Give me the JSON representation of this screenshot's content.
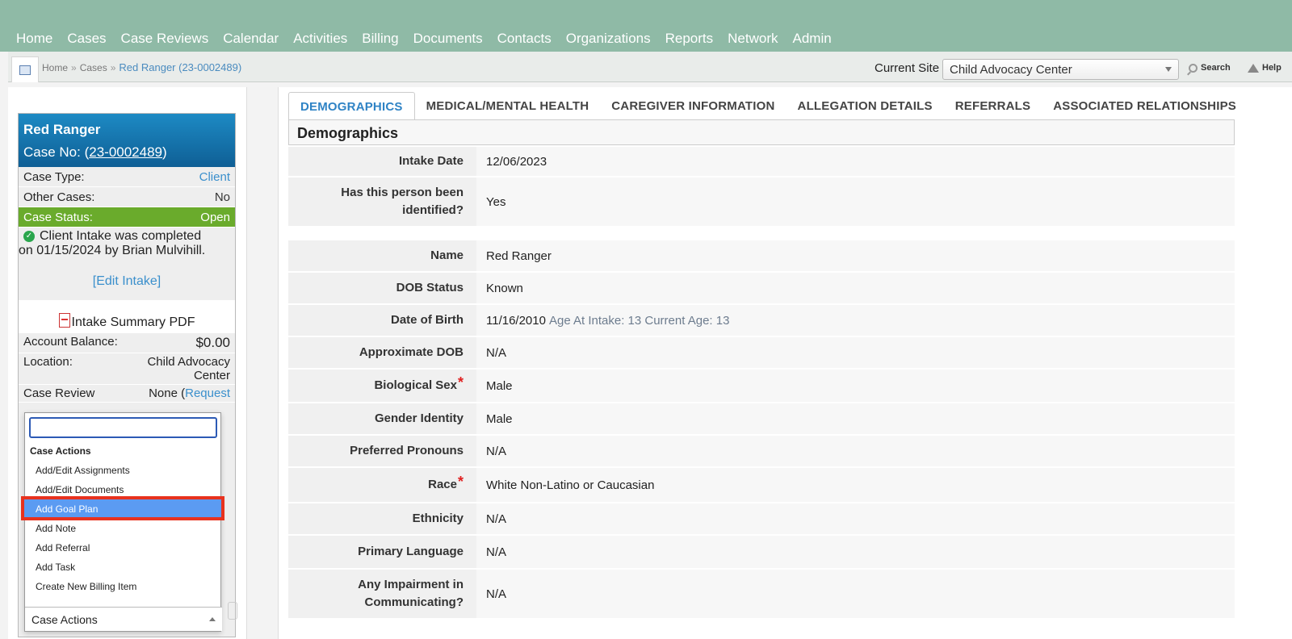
{
  "nav": {
    "items": [
      "Home",
      "Cases",
      "Case Reviews",
      "Calendar",
      "Activities",
      "Billing",
      "Documents",
      "Contacts",
      "Organizations",
      "Reports",
      "Network",
      "Admin"
    ]
  },
  "breadcrumb": {
    "home": "Home",
    "sep": "»",
    "cases": "Cases",
    "current": "Red Ranger (23-0002489)"
  },
  "site": {
    "label": "Current Site",
    "value": "Child Advocacy Center"
  },
  "toplinks": {
    "search": "Search",
    "help": "Help"
  },
  "case_card": {
    "name": "Red Ranger",
    "case_no_prefix": "Case No: (",
    "case_no": "23-0002489",
    "case_no_suffix": ")",
    "case_type_label": "Case Type:",
    "case_type_value": "Client",
    "other_cases_label": "Other Cases:",
    "other_cases_value": "No",
    "status_label": "Case Status:",
    "status_value": "Open",
    "intake_line1": "Client Intake was completed",
    "intake_line2": "on 01/15/2024 by Brian Mulvihill.",
    "edit_intake": "[Edit Intake]",
    "pdf_label": "Intake Summary PDF",
    "balance_label": "Account Balance:",
    "balance_value": "$0.00",
    "location_label": "Location:",
    "location_value_1": "Child Advocacy",
    "location_value_2": "Center",
    "review_label": "Case Review",
    "review_value_prefix": "None (",
    "review_value_link": "Request",
    "status_color": "#6aab2c",
    "head_color": "#1478b0"
  },
  "case_actions": {
    "group": "Case Actions",
    "items": [
      "Add/Edit Assignments",
      "Add/Edit Documents",
      "Add Goal Plan",
      "Add Note",
      "Add Referral",
      "Add Task",
      "Create New Billing Item"
    ],
    "selected": "Add Goal Plan",
    "footer": "Case Actions"
  },
  "tabs": [
    "DEMOGRAPHICS",
    "MEDICAL/MENTAL HEALTH",
    "CAREGIVER INFORMATION",
    "ALLEGATION DETAILS",
    "REFERRALS",
    "ASSOCIATED RELATIONSHIPS"
  ],
  "section_title": "Demographics",
  "intake_rows": [
    {
      "label": "Intake Date",
      "value": "12/06/2023"
    },
    {
      "label": "Has this person been identified?",
      "value": "Yes"
    }
  ],
  "person_rows": [
    {
      "label": "Name",
      "value": "Red Ranger"
    },
    {
      "label": "DOB Status",
      "value": "Known"
    },
    {
      "label": "Date of Birth",
      "value": "11/16/2010",
      "note": "Age At Intake: 13 Current Age: 13"
    },
    {
      "label": "Approximate DOB",
      "value": "N/A"
    },
    {
      "label": "Biological Sex",
      "value": "Male",
      "required": "*"
    },
    {
      "label": "Gender Identity",
      "value": "Male"
    },
    {
      "label": "Preferred Pronouns",
      "value": "N/A"
    },
    {
      "label": "Race",
      "value": "White Non-Latino or Caucasian",
      "required": "*"
    },
    {
      "label": "Ethnicity",
      "value": "N/A"
    },
    {
      "label": "Primary Language",
      "value": "N/A"
    },
    {
      "label": "Any Impairment in Communicating?",
      "value": "N/A"
    }
  ]
}
